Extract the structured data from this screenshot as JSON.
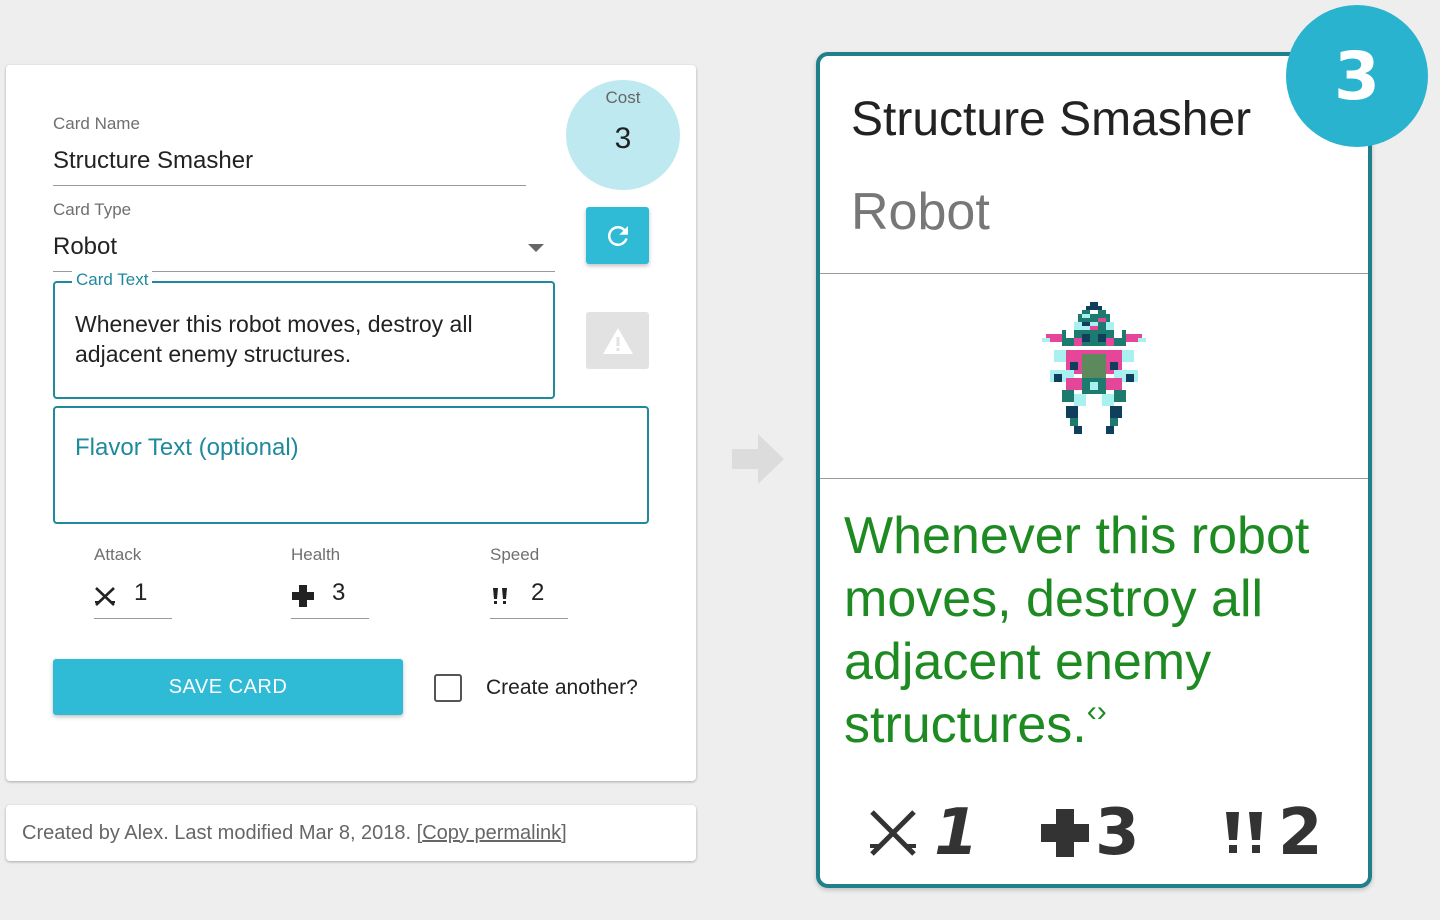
{
  "editor": {
    "card_name_label": "Card Name",
    "card_name_value": "Structure Smasher",
    "card_type_label": "Card Type",
    "card_type_value": "Robot",
    "cost_label": "Cost",
    "cost_value": "3",
    "card_text_label": "Card Text",
    "card_text_value": "Whenever this robot moves, destroy all adjacent enemy structures.",
    "flavor_placeholder": "Flavor Text (optional)",
    "attack_label": "Attack",
    "attack_value": "1",
    "health_label": "Health",
    "health_value": "3",
    "speed_label": "Speed",
    "speed_value": "2",
    "save_label": "SAVE CARD",
    "create_another_label": "Create another?",
    "create_another_checked": false
  },
  "footer": {
    "text": "Created by Alex. Last modified Mar 8, 2018. [",
    "link": "Copy permalink",
    "text_end": "]"
  },
  "preview": {
    "name": "Structure Smasher",
    "type": "Robot",
    "body_text": "Whenever this robot moves, destroy all adjacent enemy structures.",
    "keyword_marker": "‹›",
    "attack": "1",
    "health": "3",
    "speed": "2",
    "cost": "3"
  },
  "colors": {
    "accent": "#2fbad6",
    "teal_dark": "#1f8a9e",
    "card_border": "#1f7f8a",
    "card_text_green": "#1e8a22"
  }
}
